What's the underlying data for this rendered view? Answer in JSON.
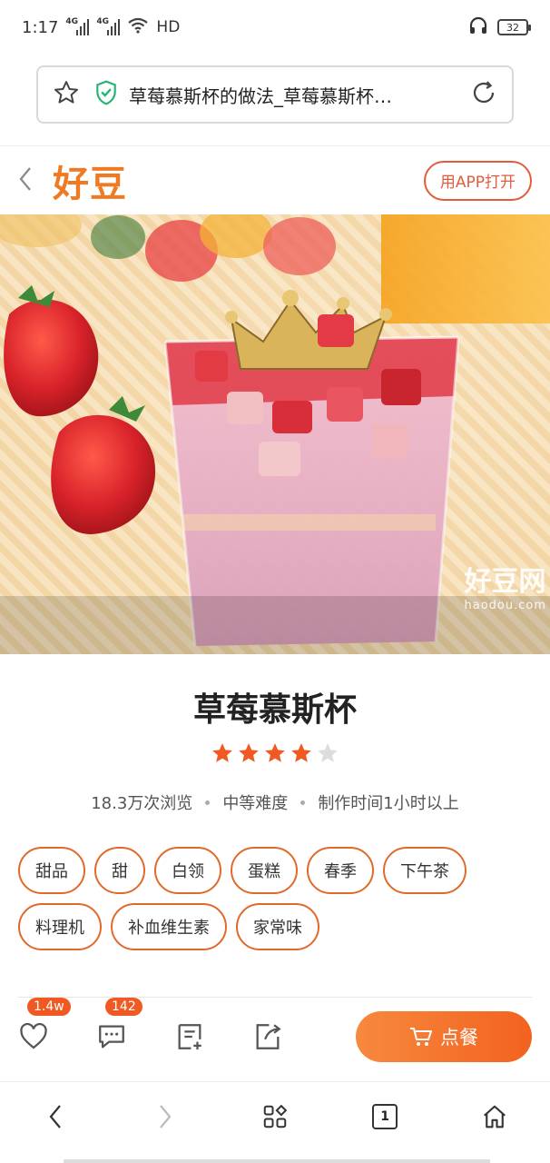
{
  "status_bar": {
    "time": "1:17",
    "signal1": "4G",
    "signal2": "4G",
    "hd": "HD",
    "battery": "32"
  },
  "address_bar": {
    "title": "草莓慕斯杯的做法_草莓慕斯杯…"
  },
  "site_header": {
    "logo": "好豆",
    "open_app_label": "用APP打开"
  },
  "hero": {
    "watermark_text": "好豆网",
    "watermark_url": "haodou.com"
  },
  "recipe": {
    "title": "草莓慕斯杯",
    "rating": 4,
    "rating_max": 5,
    "views": "18.3万次浏览",
    "difficulty": "中等难度",
    "time": "制作时间1小时以上",
    "tags": [
      "甜品",
      "甜",
      "白领",
      "蛋糕",
      "春季",
      "下午茶",
      "料理机",
      "补血维生素",
      "家常味"
    ]
  },
  "actions": {
    "like_count": "1.4w",
    "comment_count": "142",
    "order_label": "点餐"
  },
  "browser_nav": {
    "tab_count": "1"
  },
  "colors": {
    "brand_orange": "#f07a24",
    "tag_border": "#e06a2a",
    "star_on": "#f05a22",
    "star_off": "#dddddd"
  }
}
